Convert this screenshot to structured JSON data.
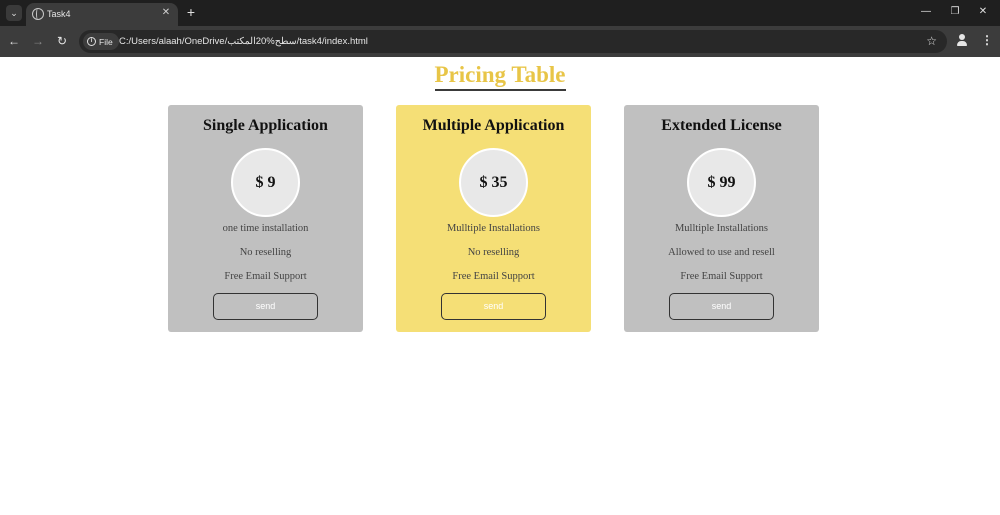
{
  "browser": {
    "tab_title": "Task4",
    "file_chip_label": "File",
    "url": "C:/Users/alaah/OneDrive/سطح%20المكتب/task4/index.html"
  },
  "page": {
    "title": "Pricing Table",
    "title_color": "#e8c547",
    "cards": [
      {
        "name": "Single Application",
        "price": "$ 9",
        "features": [
          "one time installation",
          "No reselling",
          "Free Email Support"
        ],
        "button_label": "send",
        "background": "#c0c0c0"
      },
      {
        "name": "Multiple Application",
        "price": "$ 35",
        "features": [
          "Mulltiple Installations",
          "No reselling",
          "Free Email Support"
        ],
        "button_label": "send",
        "background": "#f5df76"
      },
      {
        "name": "Extended License",
        "price": "$ 99",
        "features": [
          "Mulltiple Installations",
          "Allowed to use and resell",
          "Free Email Support"
        ],
        "button_label": "send",
        "background": "#c0c0c0"
      }
    ]
  }
}
